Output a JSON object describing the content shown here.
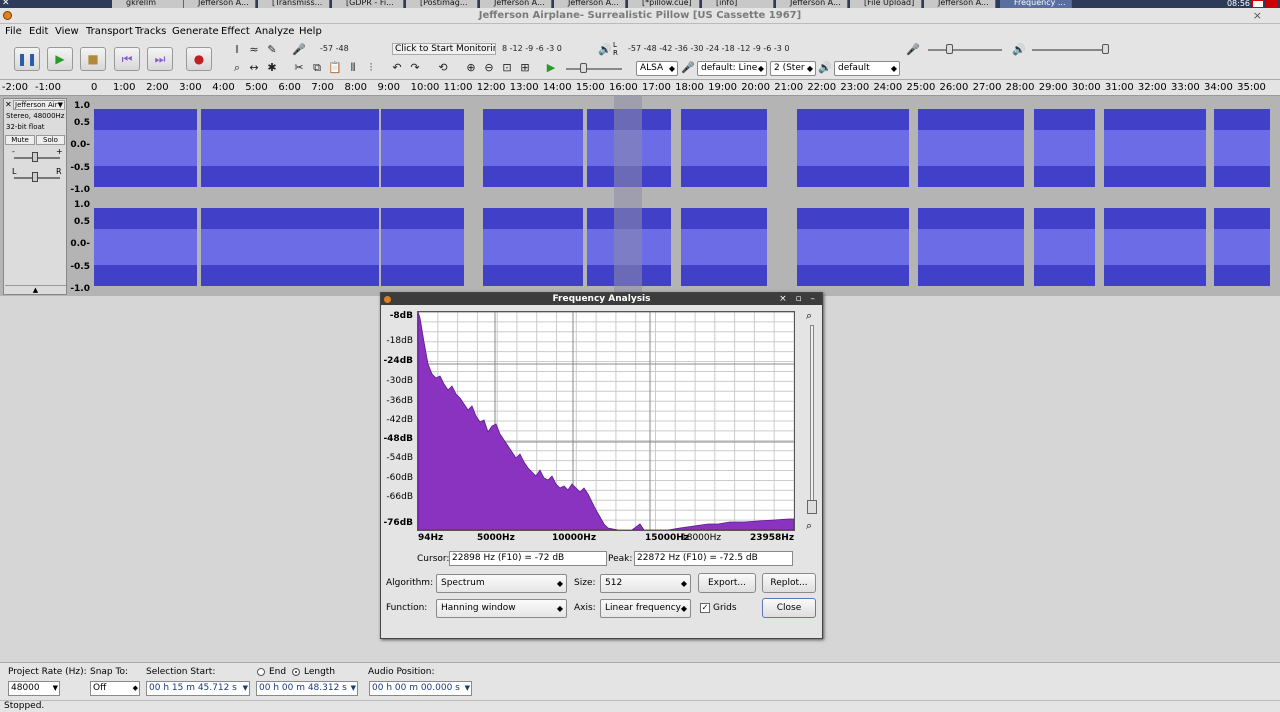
{
  "taskbar": {
    "items": [
      "gkrellm",
      "Jefferson A...",
      "[Transmiss...",
      "[GDPR - Fi...",
      "[Postimag...",
      "Jefferson A...",
      "Jefferson A...",
      "[*pillow.cue]",
      "[info]",
      "Jefferson A...",
      "[File Upload]",
      "Jefferson A...",
      "Frequency ..."
    ],
    "clock": "08:56"
  },
  "app": {
    "title": "Jefferson Airplane- Surrealistic Pillow [US Cassette 1967]",
    "close": "×"
  },
  "menubar": {
    "items": [
      "File",
      "Edit",
      "View",
      "Transport",
      "Tracks",
      "Generate",
      "Effect",
      "Analyze",
      "Help"
    ]
  },
  "toolbar": {
    "record_meter_scale": "-57    -48",
    "monitor_label": "Click to Start Monitoring",
    "record_meter_scale_2": "8    -12 -9 -6 -3 0",
    "play_meter_scale": "-57    -48    -42    -36    -30    -24    -18    -12 -9 -6 -3 0",
    "meter_r_label": "R",
    "meter_l_label": "L",
    "host": "ALSA",
    "rec_device": "default: Line",
    "channels": "2 (Ster",
    "play_device": "default"
  },
  "ruler": {
    "ticks": [
      "-2:00",
      "-1:00",
      "0",
      "1:00",
      "2:00",
      "3:00",
      "4:00",
      "5:00",
      "6:00",
      "7:00",
      "8:00",
      "9:00",
      "10:00",
      "11:00",
      "12:00",
      "13:00",
      "14:00",
      "15:00",
      "16:00",
      "17:00",
      "18:00",
      "19:00",
      "20:00",
      "21:00",
      "22:00",
      "23:00",
      "24:00",
      "25:00",
      "26:00",
      "27:00",
      "28:00",
      "29:00",
      "30:00",
      "31:00",
      "32:00",
      "33:00",
      "34:00",
      "35:00"
    ]
  },
  "track": {
    "name": "Jefferson Air",
    "info1": "Stereo, 48000Hz",
    "info2": "32-bit float",
    "mute": "Mute",
    "solo": "Solo",
    "pan_l": "L",
    "pan_r": "R",
    "gain_minus": "-",
    "gain_plus": "+",
    "db_labels": [
      "1.0",
      "0.5",
      "0.0-",
      "-0.5",
      "-1.0"
    ]
  },
  "dialog": {
    "title": "Frequency Analysis",
    "window_buttons": "× ▫ –",
    "y_labels": [
      {
        "text": "-8dB",
        "bold": true
      },
      {
        "text": "-18dB",
        "bold": false
      },
      {
        "text": "-24dB",
        "bold": true
      },
      {
        "text": "-30dB",
        "bold": false
      },
      {
        "text": "-36dB",
        "bold": false
      },
      {
        "text": "-42dB",
        "bold": false
      },
      {
        "text": "-48dB",
        "bold": true
      },
      {
        "text": "-54dB",
        "bold": false
      },
      {
        "text": "-60dB",
        "bold": false
      },
      {
        "text": "-66dB",
        "bold": false
      },
      {
        "text": "-76dB",
        "bold": true
      }
    ],
    "x_labels": [
      {
        "text": "94Hz",
        "bold": true
      },
      {
        "text": "5000Hz",
        "bold": true
      },
      {
        "text": "10000Hz",
        "bold": true
      },
      {
        "text": "15000Hz",
        "bold": true
      },
      {
        "text": "18000Hz",
        "bold": false
      },
      {
        "text": "23958Hz",
        "bold": true
      }
    ],
    "cursor_label": "Cursor:",
    "cursor_value": "22898 Hz (F10) = -72 dB",
    "peak_label": "Peak:",
    "peak_value": "22872 Hz (F10) = -72.5 dB",
    "algorithm_label": "Algorithm:",
    "algorithm_value": "Spectrum",
    "size_label": "Size:",
    "size_value": "512",
    "export_button": "Export...",
    "replot_button": "Replot...",
    "function_label": "Function:",
    "function_value": "Hanning window",
    "axis_label": "Axis:",
    "axis_value": "Linear frequency",
    "grids_label": "Grids",
    "close_button": "Close"
  },
  "selection_bar": {
    "project_rate_label": "Project Rate (Hz):",
    "project_rate_value": "48000",
    "snap_label": "Snap To:",
    "snap_value": "Off",
    "selection_start_label": "Selection Start:",
    "selection_start_value": "00 h 15 m 45.712 s",
    "end_label": "End",
    "length_label": "Length",
    "length_value": "00 h 00 m 48.312 s",
    "audio_position_label": "Audio Position:",
    "audio_position_value": "00 h 00 m 00.000 s"
  },
  "status": {
    "text": "Stopped."
  },
  "colors": {
    "waveform": "#4040c8",
    "waveform_rms": "#6c6ce6",
    "spectrum": "#8a33c0",
    "spectrum_edge": "#5a1a90"
  }
}
